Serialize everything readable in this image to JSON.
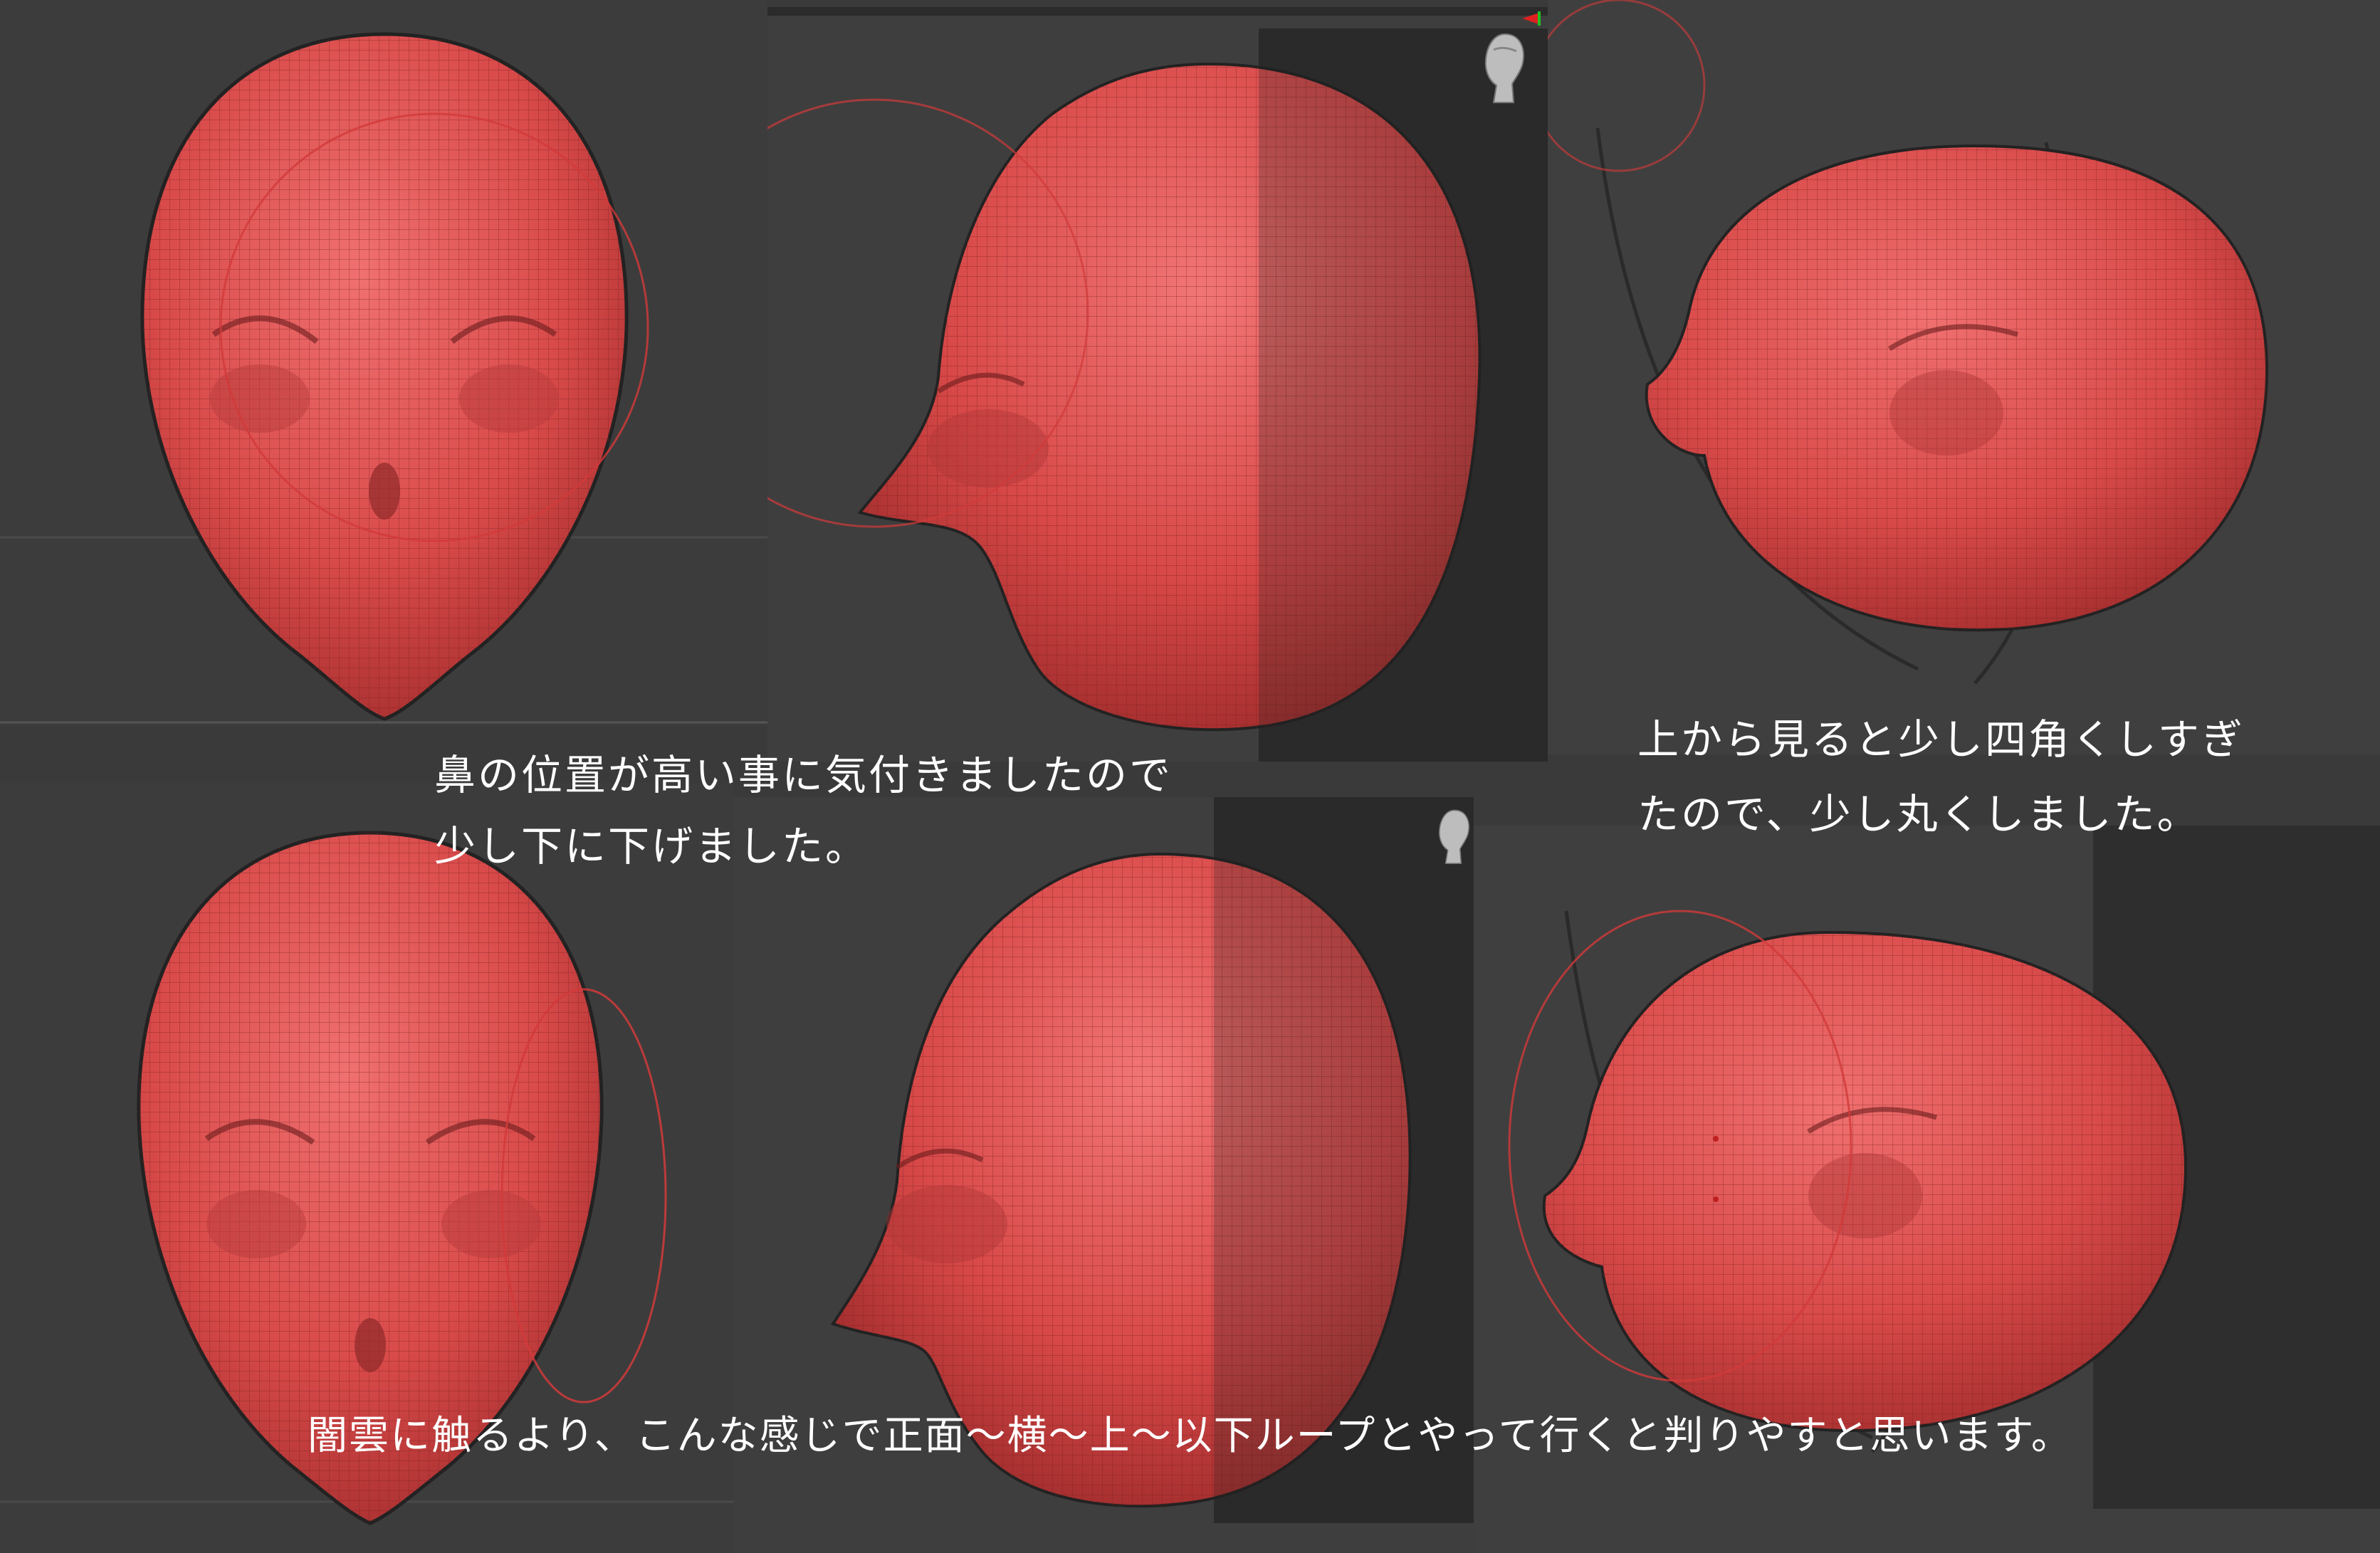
{
  "captions": {
    "nose_note_line1": "鼻の位置が高い事に気付きましたので",
    "nose_note_line2": "少し下に下げました。",
    "top_note_line1": "上から見ると少し四角くしすぎ",
    "top_note_line2": "たので、少し丸くしました。",
    "loop_note": "闇雲に触るより、こんな感じで正面～横～上～以下ループとやって行くと判りやすと思います。"
  },
  "colors": {
    "mesh_red": "#e04848",
    "viewport_bg": "#3d3d3d",
    "panel_dark": "#2f2f2f",
    "text": "#ffffff"
  },
  "icons": {
    "view_widget": "head-orientation-widget-icon",
    "axis_gizmo": "axis-gizmo-icon"
  }
}
